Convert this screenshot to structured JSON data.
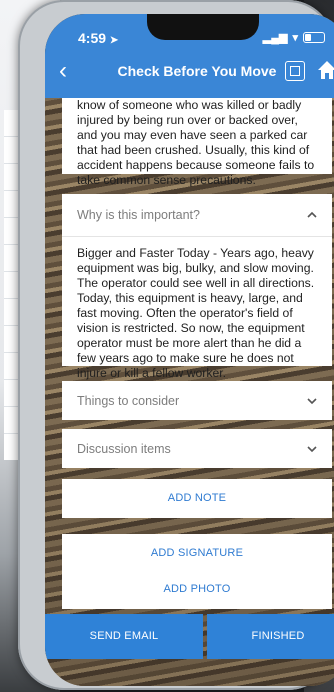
{
  "status_bar": {
    "time": "4:59",
    "signal": "▂▄▆",
    "wifi": "▾"
  },
  "nav": {
    "title": "Check Before You Move"
  },
  "intro_text": "know of someone who was killed or badly injured by being run over or backed over, and you may even have seen a parked car that had been crushed. Usually, this kind of accident happens because someone fails to take common sense precautions.",
  "sections": [
    {
      "title": "Why is this important?",
      "expanded": true,
      "body": "Bigger and Faster Today - Years ago, heavy equipment was big, bulky, and slow moving.  The operator could see well in all directions. Today, this equipment is heavy, large, and fast moving. Often the operator's field of vision is restricted. So now, the equipment operator must be more alert than he did a few years ago to make sure he does not injure or kill a fellow worker."
    },
    {
      "title": "Things to consider",
      "expanded": false
    },
    {
      "title": "Discussion items",
      "expanded": false
    }
  ],
  "buttons": {
    "add_note": "ADD NOTE",
    "add_signature": "ADD SIGNATURE",
    "add_photo": "ADD PHOTO",
    "send_email": "SEND EMAIL",
    "finished": "FINISHED"
  },
  "colors": {
    "header": "#3a86d6",
    "accent": "#2f7bd1",
    "button_blue": "#2f82d7"
  },
  "icons": [
    "back-icon",
    "qr-code-icon",
    "home-icon",
    "chevron-up-icon",
    "chevron-down-icon",
    "battery-icon",
    "location-arrow-icon"
  ]
}
